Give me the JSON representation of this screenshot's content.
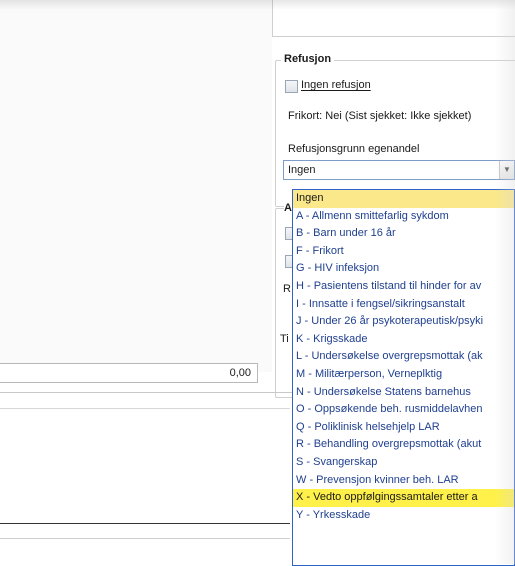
{
  "refusjon": {
    "title": "Refusjon",
    "ingen_refusjon_label": "Ingen refusjon",
    "frikort_text": "Frikort: Nei (Sist sjekket: Ikke sjekket)",
    "grunn_label": "Refusjonsgrunn egenandel",
    "selected_value": "Ingen"
  },
  "left_panel": {
    "amount_value": "0,00"
  },
  "partial_group": {
    "label_A": "A",
    "label_R": "R",
    "label_Ti": "Ti"
  },
  "dropdown": {
    "options": [
      "Ingen",
      "A - Allmenn smittefarlig sykdom",
      "B - Barn under 16 år",
      "F - Frikort",
      "G - HIV infeksjon",
      "H - Pasientens tilstand til hinder for av",
      "I - Innsatte i fengsel/sikringsanstalt",
      "J - Under 26 år psykoterapeutisk/psyki",
      "K - Krigsskade",
      "L - Undersøkelse overgrepsmottak (ak",
      "M - Militærperson, Verneplktig",
      "N - Undersøkelse Statens barnehus",
      "O - Oppsøkende beh. rusmiddelavhen",
      "Q - Poliklinisk helsehjelp LAR",
      "R - Behandling overgrepsmottak (akut",
      "S - Svangerskap",
      "W - Prevensjon kvinner beh. LAR",
      "X - Vedto oppfølgingssamtaler etter a",
      "Y - Yrkesskade"
    ],
    "selected_index": 0,
    "highlight_index": 17
  },
  "colors": {
    "dropdown_border": "#2f63c7",
    "option_text": "#1f3f8f",
    "selected_bg": "#fbe88a",
    "highlight_bg": "#fff14a"
  }
}
